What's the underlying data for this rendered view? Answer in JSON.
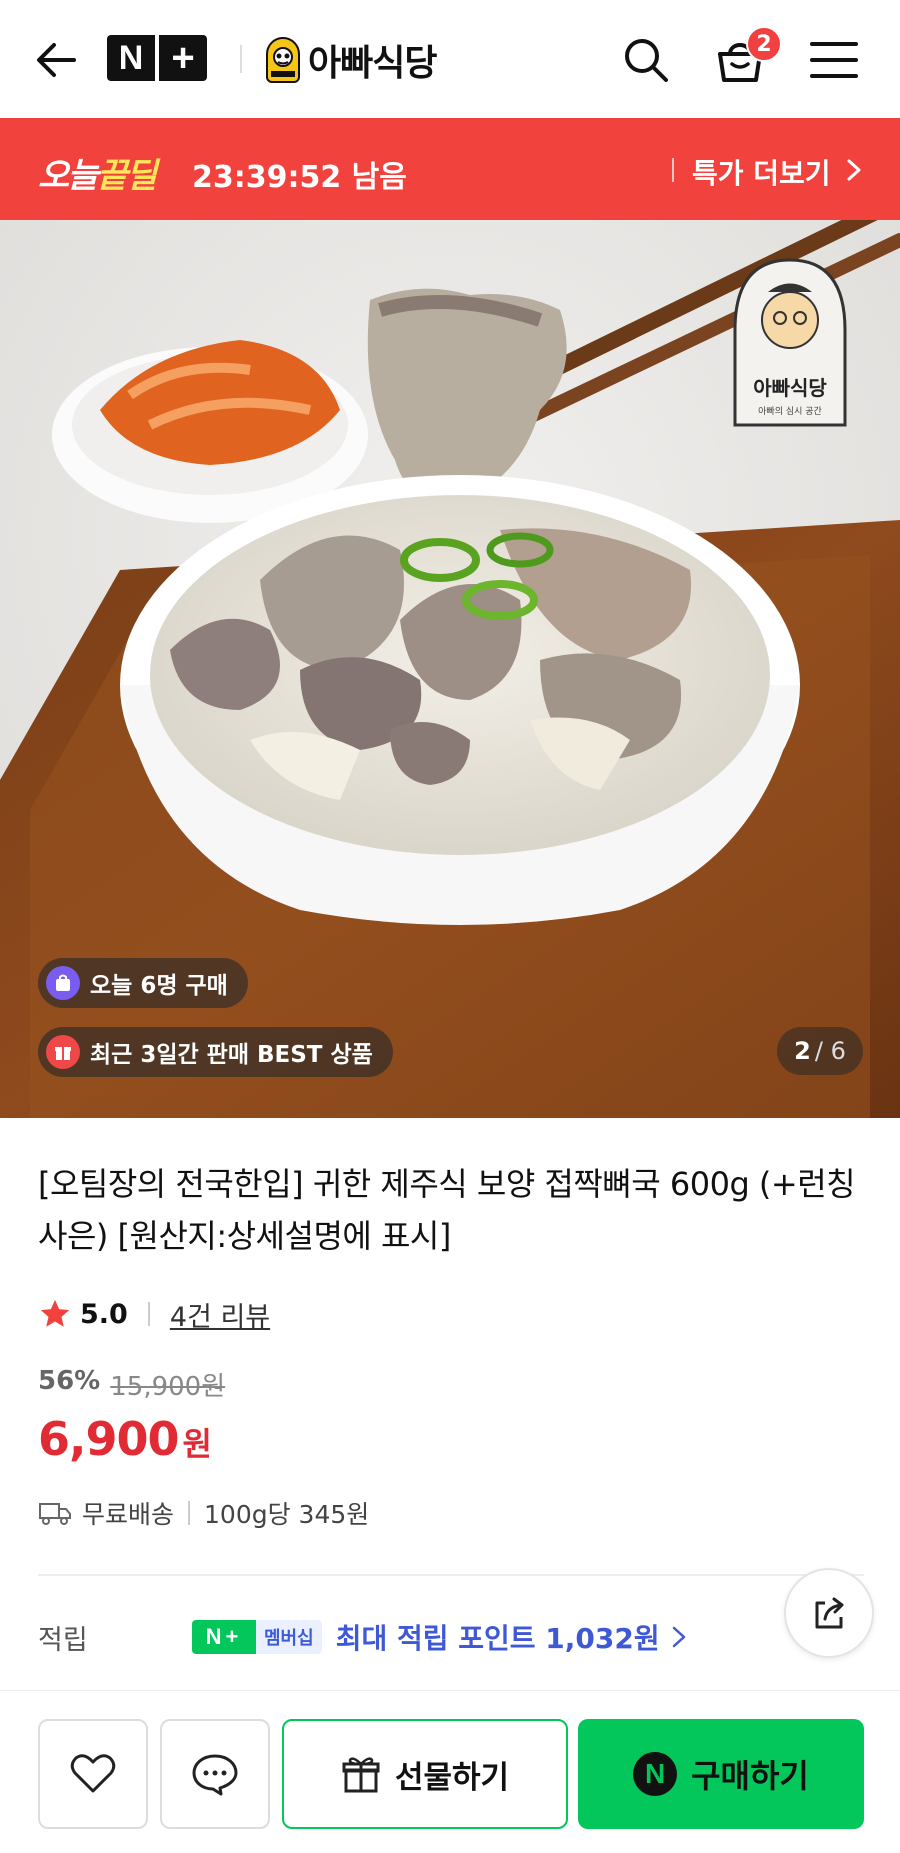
{
  "header": {
    "back_icon": "back-arrow-icon",
    "nplus_n": "N",
    "nplus_plus": "+",
    "store_name": "아빠식당",
    "search_icon": "search-icon",
    "cart_icon": "cart-icon",
    "cart_count": "2",
    "menu_icon": "hamburger-menu-icon"
  },
  "deal_banner": {
    "logo_part1": "오늘",
    "logo_part2": "끝딜",
    "timer": "23:39:52 남음",
    "more_label": "특가 더보기",
    "bg_color": "#f2423d"
  },
  "photo": {
    "brand_logo_text": "아빠식당",
    "brand_logo_sub": "아빠의 심시 공간",
    "badge_today": "오늘 6명 구매",
    "badge_best": "최근 3일간 판매 BEST 상품",
    "slide_current": "2",
    "slide_total": "/ 6"
  },
  "product": {
    "title": "[오팀장의 전국한입] 귀한 제주식 보양 접짝뼈국 600g (+런칭사은) [원산지:상세설명에 표시]",
    "rating": "5.0",
    "review_label": "4건 리뷰",
    "discount_pct": "56%",
    "original_price": "15,900원",
    "price": "6,900",
    "price_unit": "원",
    "shipping": "무료배송",
    "unit_price": "100g당 345원",
    "price_color": "#e02b35"
  },
  "points": {
    "label": "적립",
    "badge_np": "N+",
    "badge_membership": "멤버십",
    "text": "최대 적립 포인트 1,032원"
  },
  "bottom_bar": {
    "gift_label": "선물하기",
    "buy_label": "구매하기",
    "buy_n": "N",
    "accent": "#03c75a"
  }
}
